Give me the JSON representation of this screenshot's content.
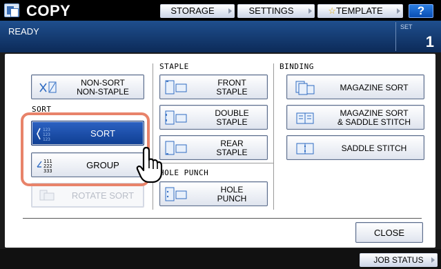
{
  "app": {
    "title": "COPY",
    "icon": "copy-icon"
  },
  "toolbar": {
    "storage_label": "STORAGE",
    "settings_label": "SETTINGS",
    "template_label": "TEMPLATE",
    "help_label": "?"
  },
  "status": {
    "ready": "READY",
    "set_label": "SET",
    "set_value": "1"
  },
  "sections": {
    "sort_label": "SORT",
    "staple_label": "STAPLE",
    "hole_punch_label": "HOLE PUNCH",
    "binding_label": "BINDING"
  },
  "sort_buttons": {
    "non_sort_line1": "NON-SORT",
    "non_sort_line2": "NON-STAPLE",
    "sort": "SORT",
    "group": "GROUP",
    "rotate_sort": "ROTATE SORT"
  },
  "staple_buttons": {
    "front_line1": "FRONT",
    "front_line2": "STAPLE",
    "double_line1": "DOUBLE",
    "double_line2": "STAPLE",
    "rear_line1": "REAR",
    "rear_line2": "STAPLE"
  },
  "hole_punch_buttons": {
    "line1": "HOLE",
    "line2": "PUNCH"
  },
  "binding_buttons": {
    "magazine_sort": "MAGAZINE SORT",
    "mag_saddle_line1": "MAGAZINE SORT",
    "mag_saddle_line2": "& SADDLE STITCH",
    "saddle_stitch": "SADDLE STITCH"
  },
  "close_label": "CLOSE",
  "job_status_label": "JOB STATUS",
  "colors": {
    "accent": "#1f4f8e",
    "selected": "#1a4fa8",
    "highlight": "#e8836a"
  }
}
